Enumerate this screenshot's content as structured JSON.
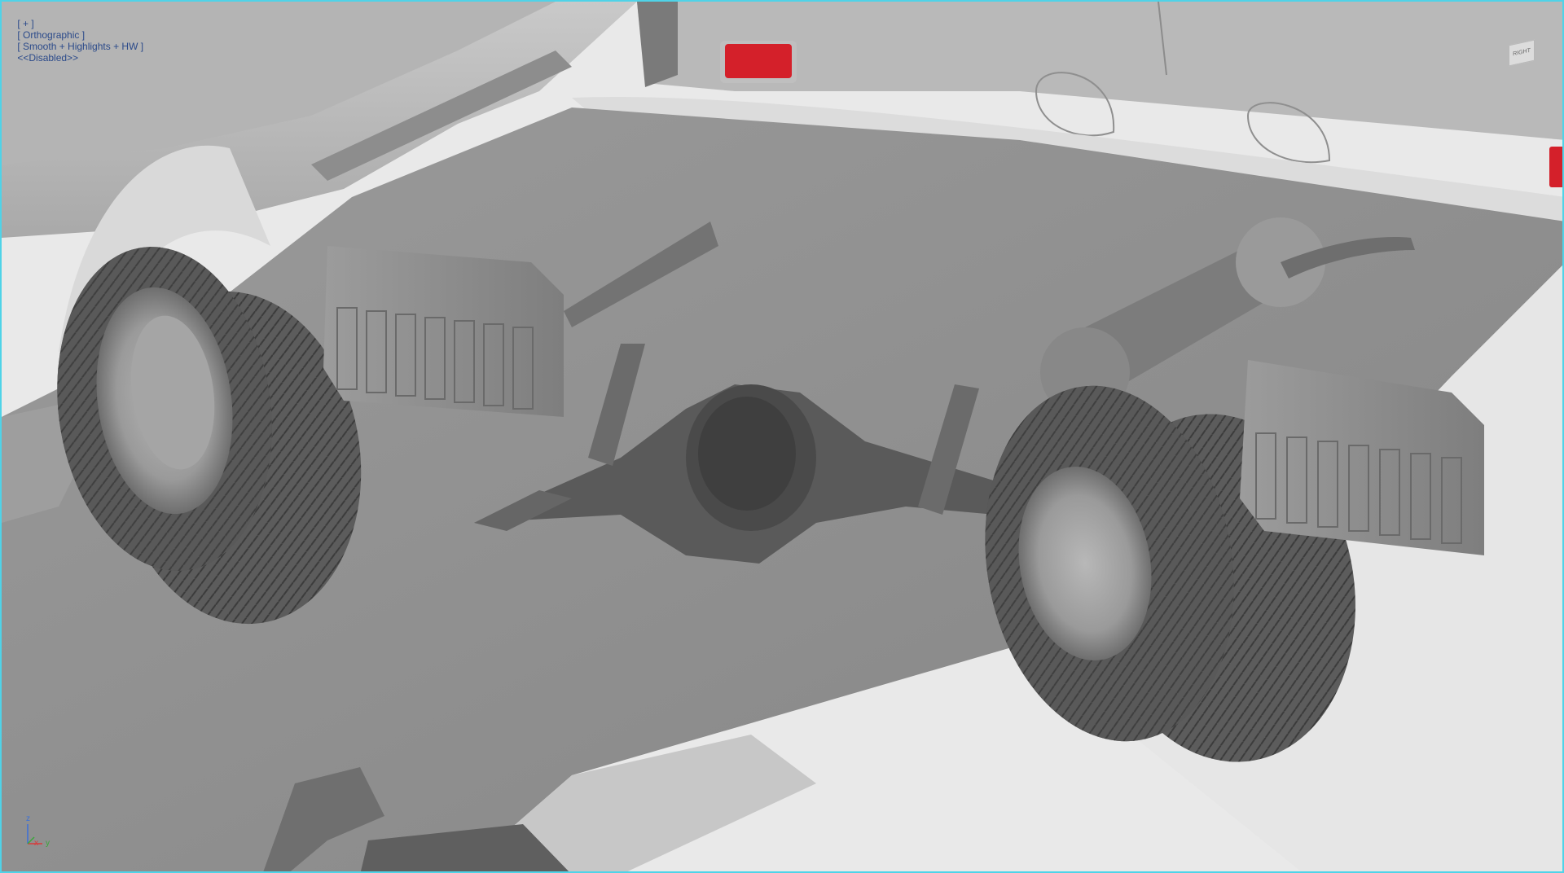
{
  "viewport": {
    "label_plus": "[ + ]",
    "label_view": "[ Orthographic ]",
    "label_shading": "[ Smooth + Highlights + HW ]",
    "label_extra": "<<Disabled>>",
    "border_color": "#4fd3e8"
  },
  "viewcube": {
    "face_label": "RIGHT"
  },
  "axis_gizmo": {
    "z": "z",
    "x": "x",
    "y": "y",
    "colors": {
      "z": "#3a6fd8",
      "x": "#d83a3a",
      "y": "#3aa83a"
    }
  },
  "icons": [
    "viewcube-icon",
    "axis-gizmo-icon"
  ],
  "colors": {
    "reflector": "#d4202a",
    "model_grey": "#8a8a8a",
    "background": "#ececec"
  }
}
